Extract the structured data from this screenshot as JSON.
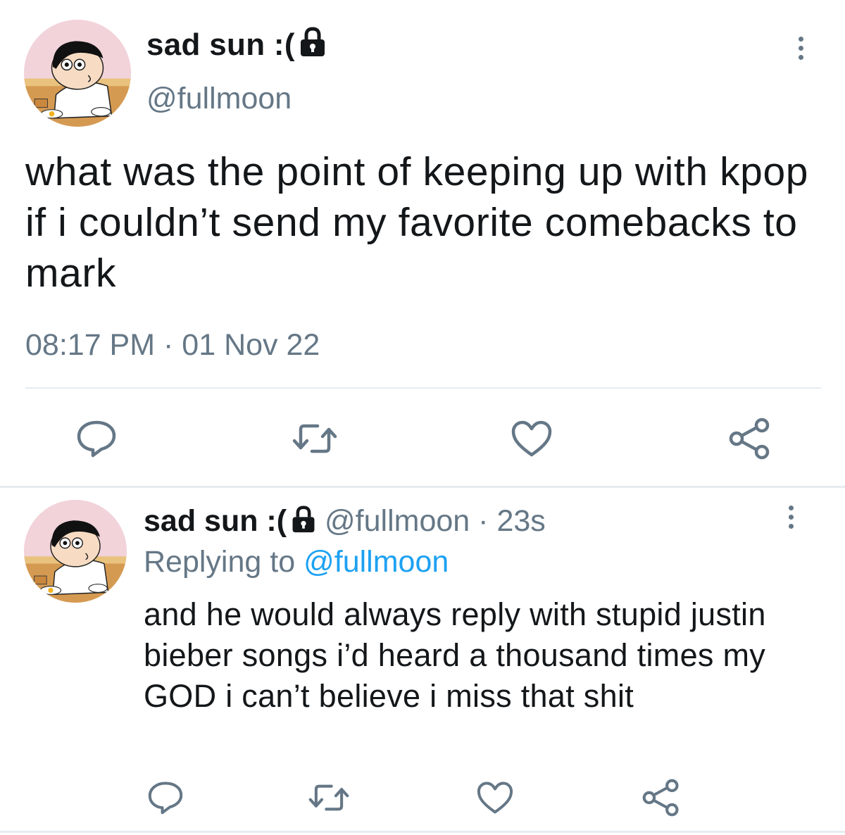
{
  "main_tweet": {
    "display_name": "sad sun :(",
    "handle": "@fullmoon",
    "text": "what was the point of keeping up with kpop if i couldn’t send my favorite comebacks to mark",
    "time": "08:17 PM",
    "separator": "·",
    "date": "01 Nov 22",
    "avatar": "crayon-shin-chan-eating-avatar",
    "protected_icon": "lock-icon"
  },
  "reply_tweet": {
    "display_name": "sad sun :(",
    "handle": "@fullmoon",
    "separator": "·",
    "age": "23s",
    "replying_prefix": "Replying to",
    "replying_handle": "@fullmoon",
    "text": "and he would always reply with stupid justin bieber songs i’d heard a thousand times my GOD i can’t believe i miss that shit",
    "avatar": "crayon-shin-chan-eating-avatar",
    "protected_icon": "lock-icon"
  },
  "actions": {
    "icons": [
      "reply-icon",
      "retweet-icon",
      "like-icon",
      "share-icon"
    ]
  },
  "colors": {
    "text": "#14171a",
    "secondary": "#657786",
    "link": "#1da1f2",
    "divider": "#e6ecf0"
  }
}
